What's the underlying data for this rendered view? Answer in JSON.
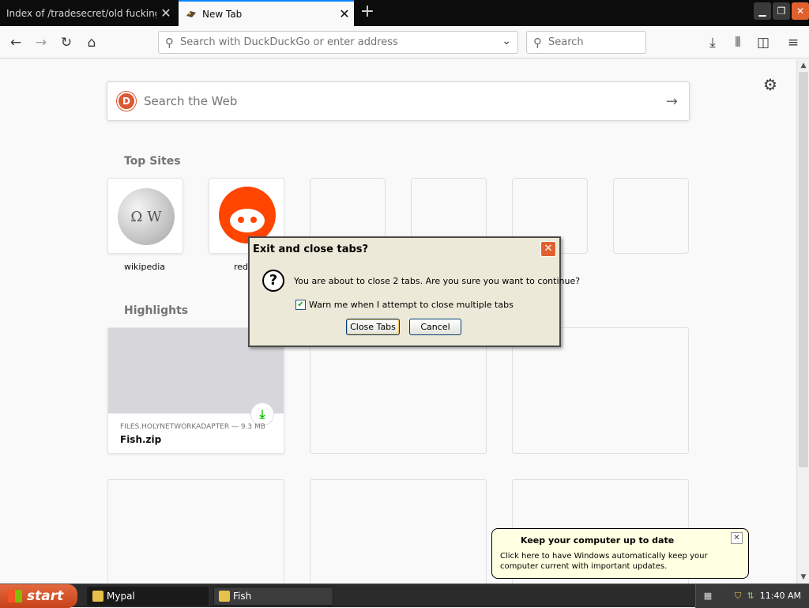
{
  "tabs": [
    {
      "title": "Index of /tradesecret/old fucking garb",
      "active": false
    },
    {
      "title": "New Tab",
      "active": true
    }
  ],
  "window_controls": {
    "minimize": "▁",
    "maximize": "❐",
    "close": "✕"
  },
  "urlbar": {
    "placeholder": "Search with DuckDuckGo or enter address"
  },
  "searchbar": {
    "placeholder": "Search"
  },
  "newtab": {
    "search_placeholder": "Search the Web",
    "top_sites_title": "Top Sites",
    "top_sites": [
      {
        "label": "wikipedia"
      },
      {
        "label": "red"
      }
    ],
    "highlights_title": "Highlights",
    "highlight": {
      "source": "FILES.HOLYNETWORKADAPTER — 9.3 MB",
      "name": "Fish.zip"
    }
  },
  "dialog": {
    "title": "Exit and close tabs?",
    "message": "You are about to close 2 tabs. Are you sure you want to continue?",
    "checkbox_label": "Warn me when I attempt to close multiple tabs",
    "checkbox_checked": true,
    "confirm_label": "Close Tabs",
    "cancel_label": "Cancel"
  },
  "balloon": {
    "title": "Keep your computer up to date",
    "text": "Click here to have Windows automatically keep your computer current with important updates."
  },
  "taskbar": {
    "start_label": "start",
    "items": [
      {
        "label": "Mypal",
        "active": true
      },
      {
        "label": "Fish",
        "active": false
      }
    ],
    "clock": "11:40 AM"
  },
  "colors": {
    "accent": "#0a84ff",
    "reddit": "#ff4500",
    "ddg": "#de5833",
    "download": "#12bc00",
    "balloon": "#ffffe1",
    "dialog": "#ece9d8"
  }
}
